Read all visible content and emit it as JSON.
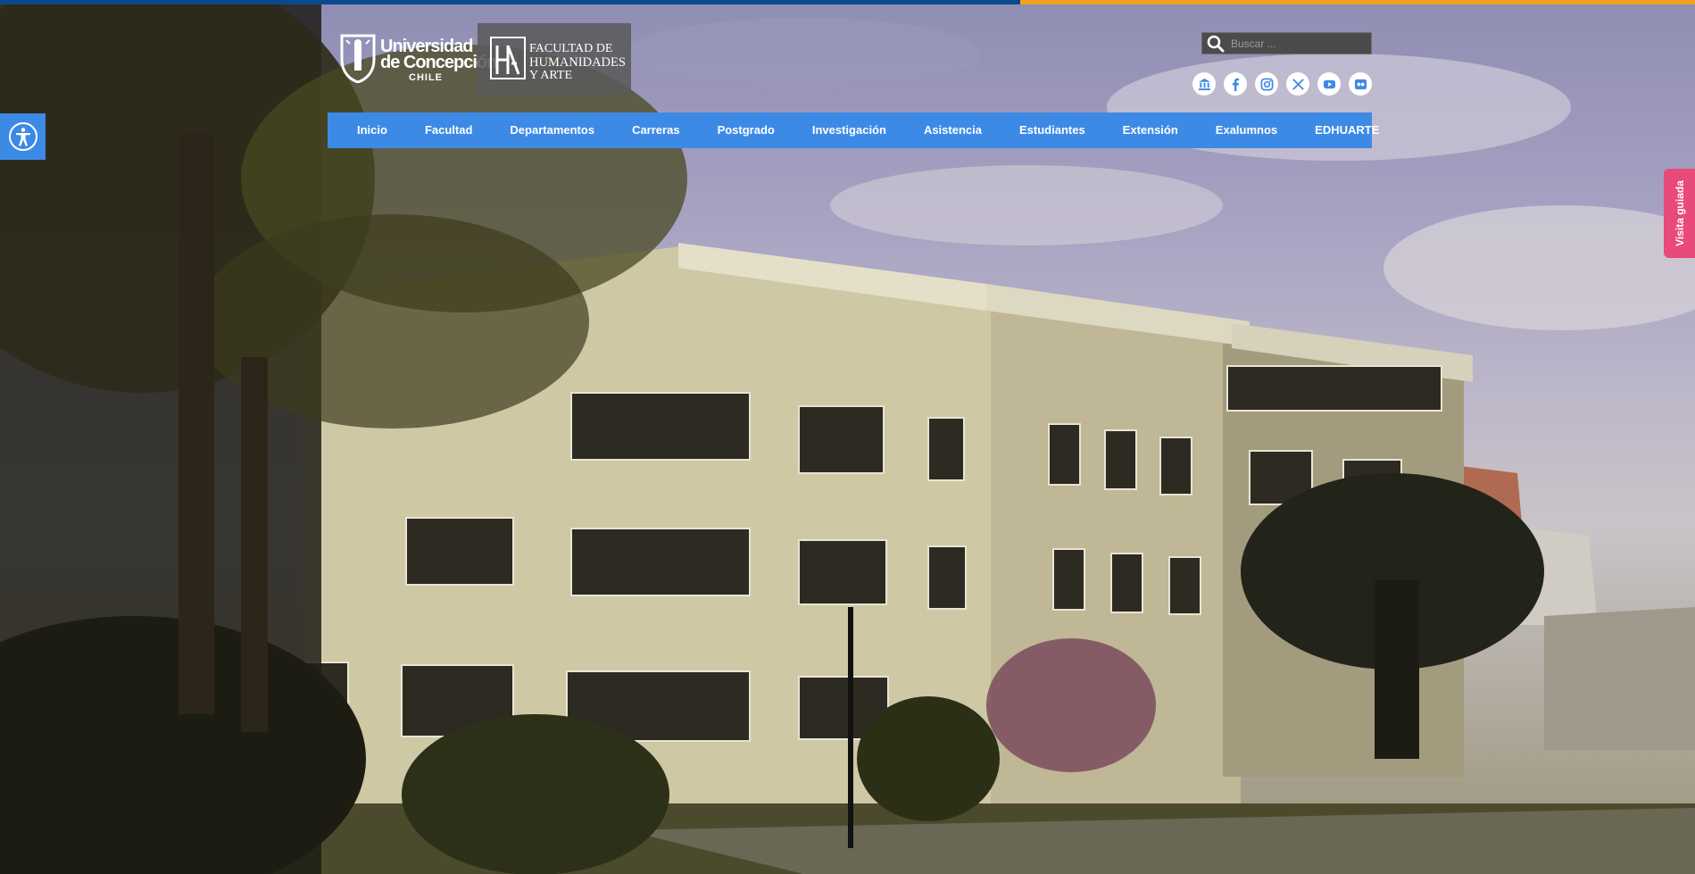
{
  "header": {
    "university_logo": {
      "line1": "Universidad",
      "line2": "de Concepción",
      "line3": "CHILE"
    },
    "faculty_logo": {
      "line1": "FACULTAD DE",
      "line2": "HUMANIDADES",
      "line3": "Y ARTE"
    }
  },
  "search": {
    "placeholder": "Buscar ..."
  },
  "social": [
    {
      "icon": "institution-icon"
    },
    {
      "icon": "facebook-icon"
    },
    {
      "icon": "instagram-icon"
    },
    {
      "icon": "x-twitter-icon"
    },
    {
      "icon": "youtube-icon"
    },
    {
      "icon": "flickr-icon"
    }
  ],
  "nav": {
    "items": [
      "Inicio",
      "Facultad",
      "Departamentos",
      "Carreras",
      "Postgrado",
      "Investigación",
      "Asistencia",
      "Estudiantes",
      "Extensión",
      "Exalumnos",
      "EDHUARTE"
    ]
  },
  "accessibility": {
    "icon": "accessibility-icon"
  },
  "guided_tour": {
    "label": "Visita guiada"
  },
  "colors": {
    "nav_blue": "#3d8ae6",
    "stripe_blue": "#0a4a8c",
    "stripe_orange": "#f2a324",
    "tour_pink": "#e84a79"
  }
}
